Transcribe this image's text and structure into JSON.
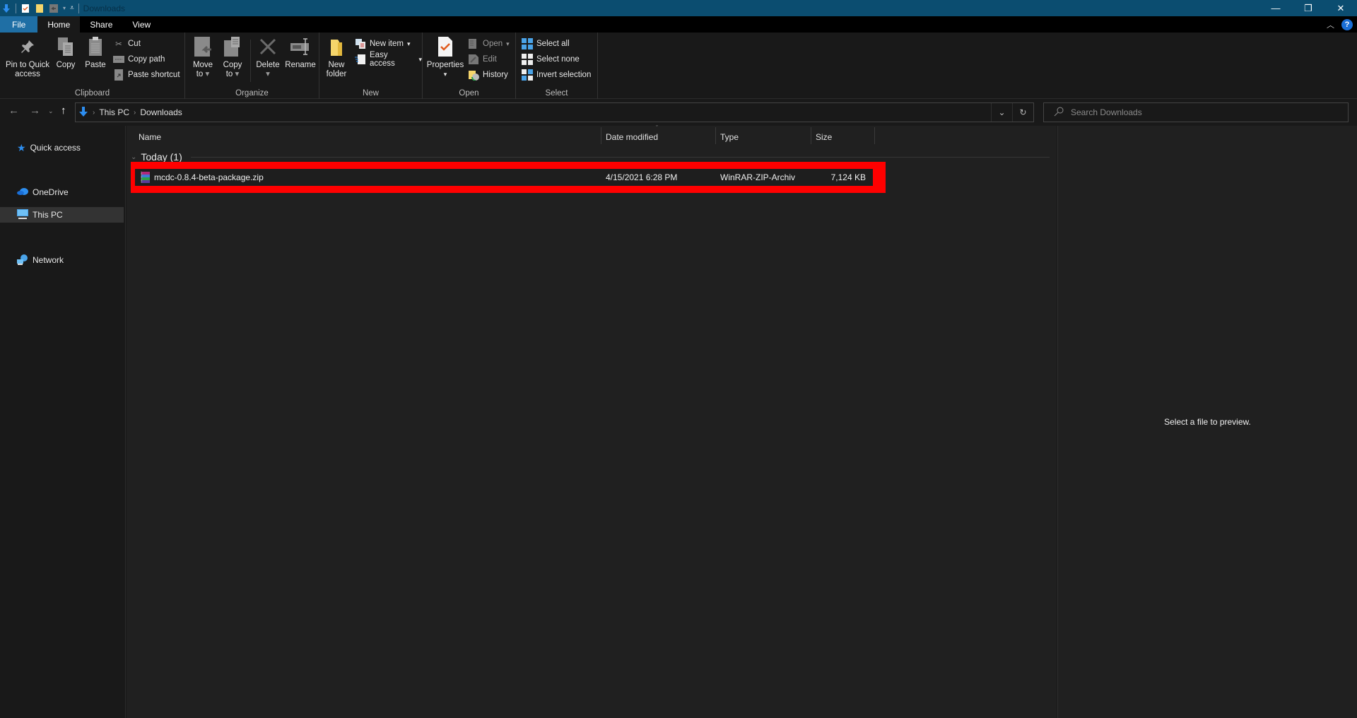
{
  "window": {
    "title": "Downloads",
    "controls": {
      "minimize": "—",
      "maximize": "❐",
      "close": "✕"
    }
  },
  "quick_access_toolbar": {
    "icons": [
      "downloads-arrow-icon",
      "properties-icon",
      "new-folder-icon",
      "undo-icon",
      "customize-qat-icon"
    ]
  },
  "tabs": [
    {
      "label": "File"
    },
    {
      "label": "Home",
      "active": true
    },
    {
      "label": "Share"
    },
    {
      "label": "View"
    }
  ],
  "ribbon": {
    "groups": {
      "clipboard": {
        "label": "Clipboard",
        "pin": "Pin to Quick access",
        "pin_line1": "Pin to Quick",
        "pin_line2": "access",
        "copy": "Copy",
        "paste": "Paste",
        "cut": "Cut",
        "copy_path": "Copy path",
        "paste_shortcut": "Paste shortcut"
      },
      "organize": {
        "label": "Organize",
        "move_to_line1": "Move",
        "move_to_line2": "to",
        "copy_to_line1": "Copy",
        "copy_to_line2": "to",
        "delete": "Delete",
        "rename": "Rename"
      },
      "new": {
        "label": "New",
        "new_folder_line1": "New",
        "new_folder_line2": "folder",
        "new_item": "New item",
        "easy_access": "Easy access"
      },
      "open": {
        "label": "Open",
        "properties": "Properties",
        "open": "Open",
        "edit": "Edit",
        "history": "History"
      },
      "select": {
        "label": "Select",
        "select_all": "Select all",
        "select_none": "Select none",
        "invert_selection": "Invert selection"
      }
    }
  },
  "address_bar": {
    "breadcrumbs": [
      "This PC",
      "Downloads"
    ]
  },
  "search": {
    "placeholder": "Search Downloads"
  },
  "nav_pane": {
    "items": [
      {
        "label": "Quick access",
        "icon": "star-icon"
      },
      {
        "label": "OneDrive",
        "icon": "cloud-icon"
      },
      {
        "label": "This PC",
        "icon": "computer-icon",
        "selected": true
      },
      {
        "label": "Network",
        "icon": "network-icon"
      }
    ]
  },
  "file_list": {
    "columns": [
      "Name",
      "Date modified",
      "Type",
      "Size"
    ],
    "groups": [
      {
        "label": "Today (1)",
        "files": [
          {
            "name": "mcdc-0.8.4-beta-package.zip",
            "date_modified": "4/15/2021 6:28 PM",
            "type": "WinRAR-ZIP-Archiv",
            "size": "7,124 KB",
            "highlighted": true
          }
        ]
      }
    ]
  },
  "preview_pane": {
    "message": "Select a file to preview."
  },
  "colors": {
    "titlebar": "#0b4d70",
    "file_tab": "#1f6fa5",
    "highlight_box": "#ff0000",
    "background": "#191919",
    "content_bg": "#202020"
  }
}
